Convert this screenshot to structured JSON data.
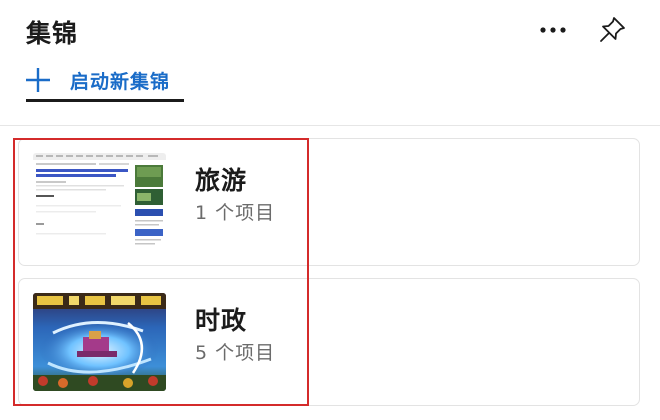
{
  "header": {
    "title": "集锦",
    "more_icon": "more-horizontal-icon",
    "pin_icon": "pin-icon"
  },
  "new_collection": {
    "icon": "plus-icon",
    "label": "启动新集锦"
  },
  "collections": [
    {
      "name": "旅游",
      "count": "1 个项目",
      "thumbnail": "webpage-screenshot"
    },
    {
      "name": "时政",
      "count": "5 个项目",
      "thumbnail": "game-screenshot"
    }
  ],
  "colors": {
    "accent": "#1a6cc8",
    "highlight_border": "#d42b2b",
    "title_text": "#1b1b1b",
    "secondary_text": "#6b6b6b"
  }
}
